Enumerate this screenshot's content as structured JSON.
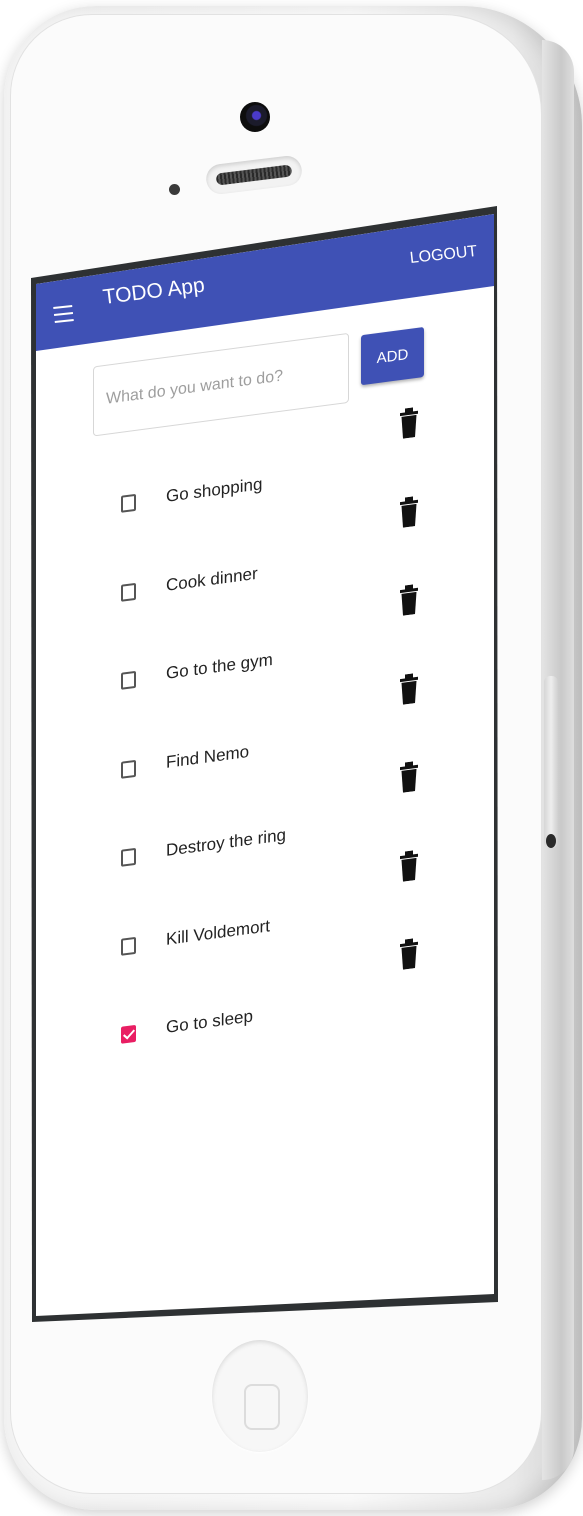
{
  "app": {
    "title": "TODO App",
    "logout_label": "LOGOUT"
  },
  "form": {
    "placeholder": "What do you want to do?",
    "value": "",
    "add_label": "ADD"
  },
  "todos": [
    {
      "text": "Go shopping",
      "done": false
    },
    {
      "text": "Cook dinner",
      "done": false
    },
    {
      "text": "Go to the gym",
      "done": false
    },
    {
      "text": "Find Nemo",
      "done": false
    },
    {
      "text": "Destroy the ring",
      "done": false
    },
    {
      "text": "Kill Voldemort",
      "done": false
    },
    {
      "text": "Go to sleep",
      "done": true
    }
  ],
  "icons": {
    "menu": "hamburger-menu-icon",
    "delete": "trash-icon",
    "check": "checkmark-icon"
  },
  "colors": {
    "primary": "#3f51b5",
    "accent": "#e91e63",
    "screen_frame": "#2e3133"
  }
}
